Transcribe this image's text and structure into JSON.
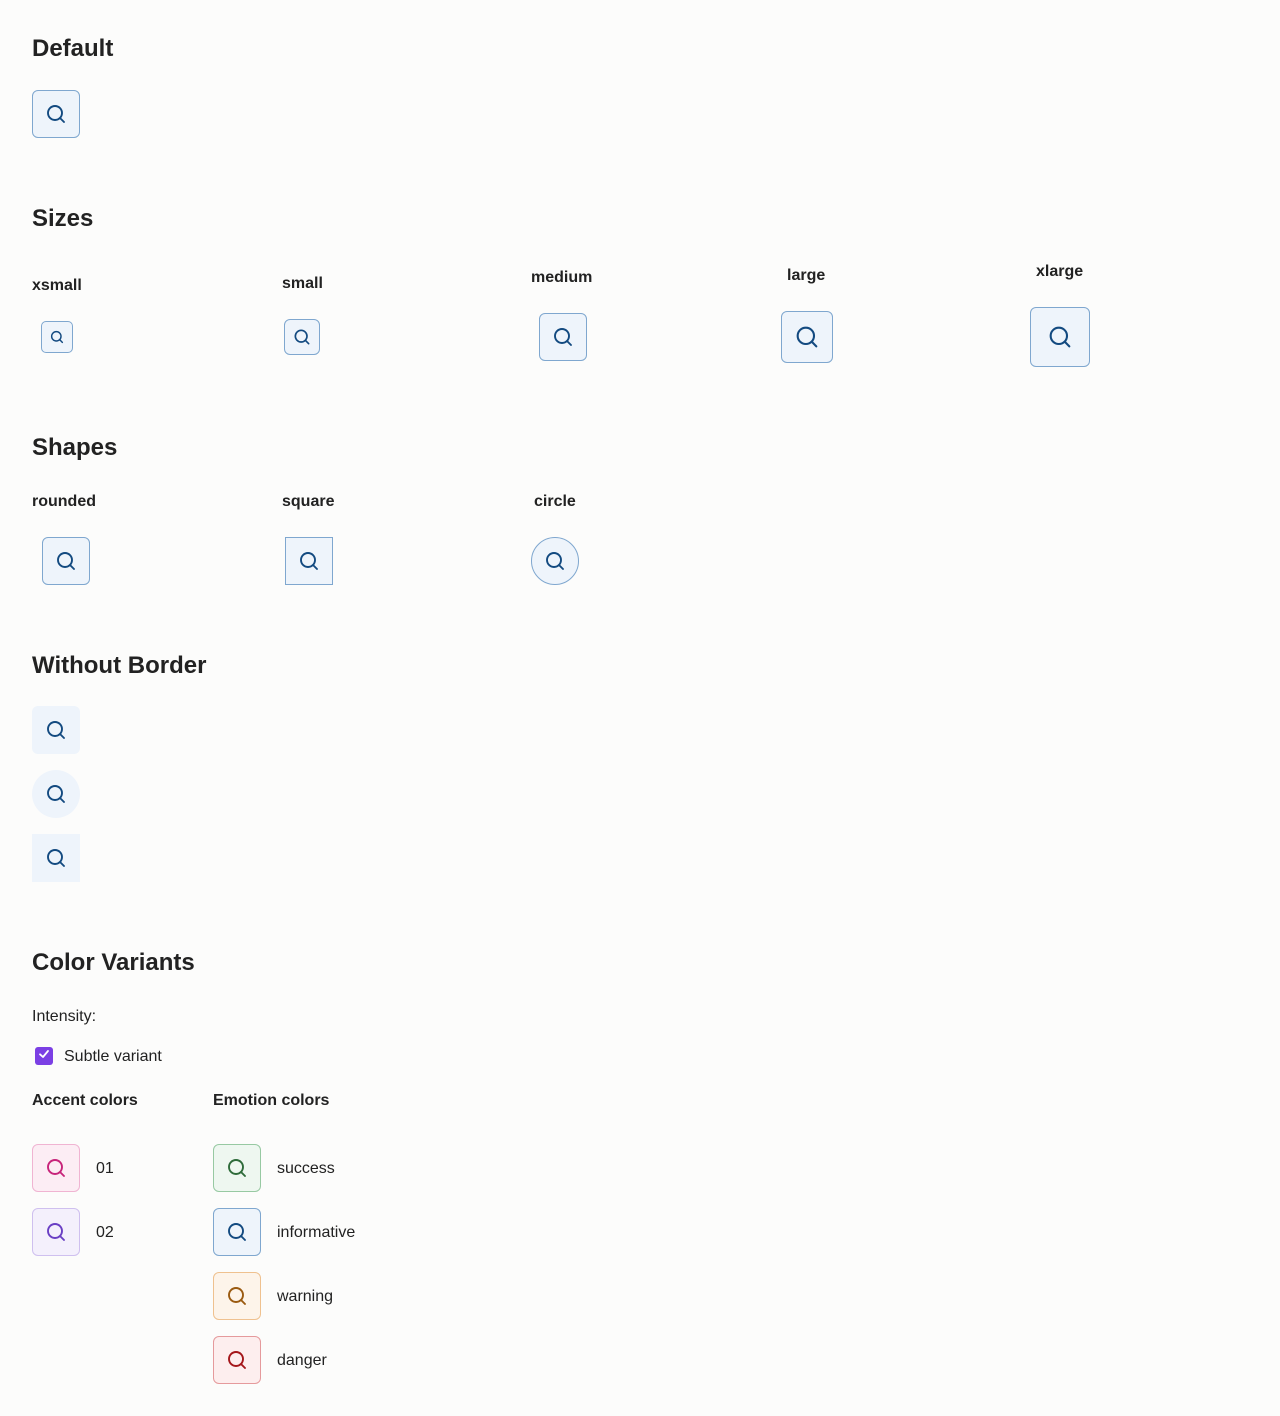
{
  "sections": {
    "default": {
      "title": "Default"
    },
    "sizes": {
      "title": "Sizes",
      "labels": [
        "xsmall",
        "small",
        "medium",
        "large",
        "xlarge"
      ]
    },
    "shapes": {
      "title": "Shapes",
      "labels": [
        "rounded",
        "square",
        "circle"
      ]
    },
    "without_border": {
      "title": "Without Border"
    },
    "color_variants": {
      "title": "Color Variants",
      "intensity_label": "Intensity:",
      "subtle_label": "Subtle variant",
      "subtle_checked": true,
      "accent_heading": "Accent colors",
      "emotion_heading": "Emotion colors",
      "accent": [
        {
          "label": "01",
          "color": "#c7247a",
          "bg": "#fcedf4",
          "border": "#f0b4d2"
        },
        {
          "label": "02",
          "color": "#6a3fc4",
          "bg": "#f4f0fc",
          "border": "#cfc0ef"
        }
      ],
      "emotion": [
        {
          "label": "success",
          "color": "#2e6b3a",
          "bg": "#eef7f0",
          "border": "#97c9a2"
        },
        {
          "label": "informative",
          "color": "#134a80",
          "bg": "#eef4fb",
          "border": "#7fa7cf"
        },
        {
          "label": "warning",
          "color": "#9a5a10",
          "bg": "#fdf4ea",
          "border": "#efc18f"
        },
        {
          "label": "danger",
          "color": "#a4161a",
          "bg": "#fdeeee",
          "border": "#e59a9c"
        }
      ]
    }
  },
  "icon": "search-icon",
  "colors": {
    "informative": "#134a80",
    "checkbox": "#7b3fe4"
  }
}
